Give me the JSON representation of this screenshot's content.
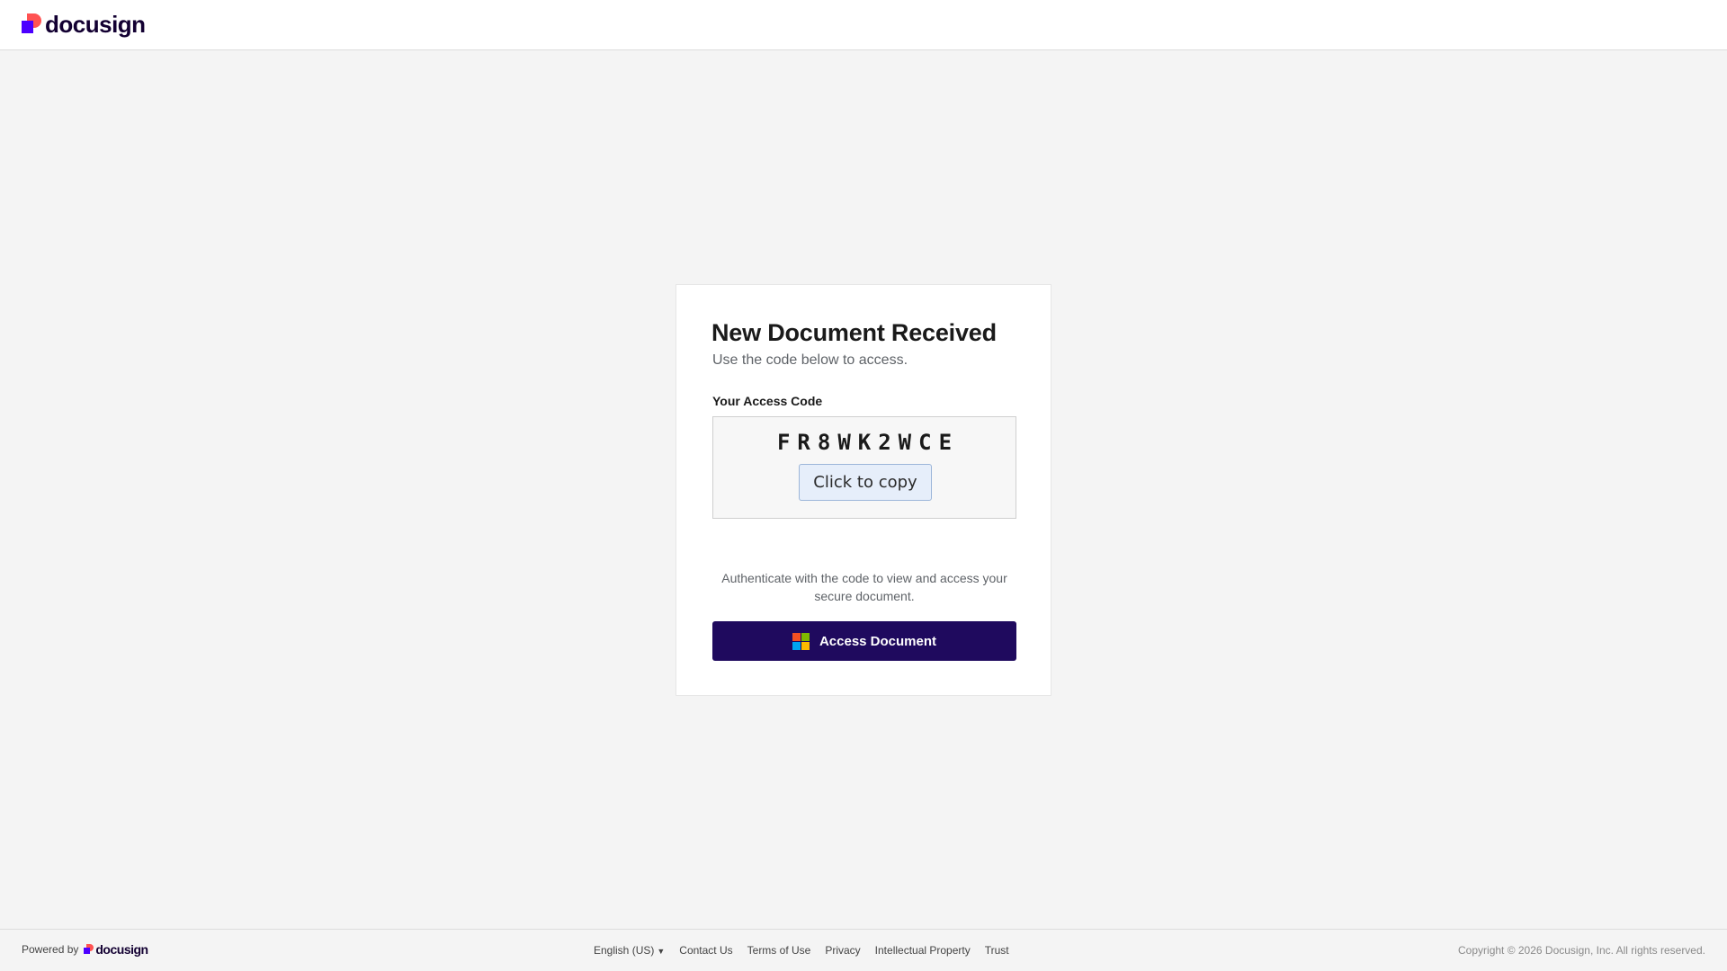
{
  "header": {
    "logo_text": "docusign"
  },
  "card": {
    "title": "New Document Received",
    "subtitle": "Use the code below to access.",
    "code_label": "Your Access Code",
    "access_code": "FR8WK2WCE",
    "copy_button_label": "Click to copy",
    "auth_text": "Authenticate with the code to view and access your secure document.",
    "access_button_label": "Access Document",
    "access_button_icon": "microsoft-icon"
  },
  "footer": {
    "powered_by": "Powered by",
    "logo_text": "docusign",
    "language": "English (US)",
    "links": [
      "Contact Us",
      "Terms of Use",
      "Privacy",
      "Intellectual Property",
      "Trust"
    ],
    "copyright": "Copyright © 2026 Docusign, Inc. All rights reserved."
  },
  "colors": {
    "brand_purple": "#4c00ff",
    "brand_coral": "#ff5252",
    "primary_button": "#1f0a5e",
    "copy_button_bg": "#e6eefa",
    "page_bg": "#f4f4f4",
    "microsoft_red": "#f25022",
    "microsoft_green": "#7fba00",
    "microsoft_blue": "#00a4ef",
    "microsoft_yellow": "#ffb900"
  }
}
